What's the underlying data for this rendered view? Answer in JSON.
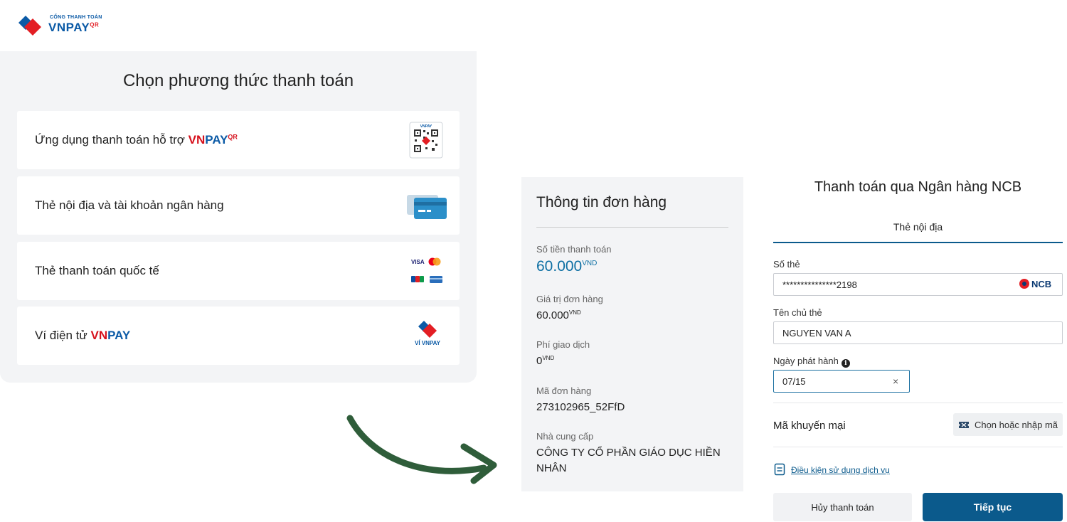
{
  "logo": {
    "small_text": "CỔNG THANH TOÁN",
    "brand": "VNPAY",
    "brand_sup": "QR"
  },
  "methods": {
    "title": "Chọn phương thức thanh toán",
    "items": [
      {
        "label": "Ứng dụng thanh toán hỗ trợ ",
        "brand_red": "VN",
        "brand_blue": "PAY",
        "brand_sup": "QR",
        "icon": "qr-code-icon"
      },
      {
        "label": "Thẻ nội địa và tài khoản ngân hàng",
        "icon": "bank-card-icon"
      },
      {
        "label": "Thẻ thanh toán quốc tế",
        "icon": "international-cards-icon"
      },
      {
        "label": "Ví điện tử ",
        "brand_red": "VN",
        "brand_blue": "PAY",
        "icon": "vi-vnpay-icon"
      }
    ],
    "qr_caption": "VNPAY",
    "wallet_caption": "VÍ VNPAY",
    "visa_text": "VISA"
  },
  "order": {
    "title": "Thông tin đơn hàng",
    "amount_label": "Số tiền thanh toán",
    "amount_value": "60.000",
    "currency": "VND",
    "order_value_label": "Giá trị đơn hàng",
    "order_value": "60.000",
    "fee_label": "Phí giao dịch",
    "fee_value": "0",
    "order_code_label": "Mã đơn hàng",
    "order_code": "273102965_52FfD",
    "provider_label": "Nhà cung cấp",
    "provider_line1": "CÔNG TY CỔ PHẦN GIÁO DỤC HIỀN",
    "provider_line2": "NHÂN"
  },
  "payment": {
    "title": "Thanh toán qua Ngân hàng NCB",
    "tab": "Thẻ nội địa",
    "card_number_label": "Số thẻ",
    "card_number_value": "***************2198",
    "bank_logo": "NCB",
    "holder_label": "Tên chủ thẻ",
    "holder_value": "NGUYEN VAN A",
    "issue_date_label": "Ngày phát hành",
    "issue_date_value": "07/15",
    "clear_symbol": "×",
    "info_symbol": "i",
    "promo_label": "Mã khuyến mại",
    "promo_button": "Chọn hoặc nhập mã",
    "terms_link": "Điều kiện sử dụng dịch vụ",
    "cancel_button": "Hủy thanh toán",
    "continue_button": "Tiếp tục"
  },
  "colors": {
    "brand_blue": "#0b5a8c",
    "brand_red": "#d6111c",
    "amount_blue": "#0d6fa3",
    "arrow_green": "#2f5d3a"
  }
}
